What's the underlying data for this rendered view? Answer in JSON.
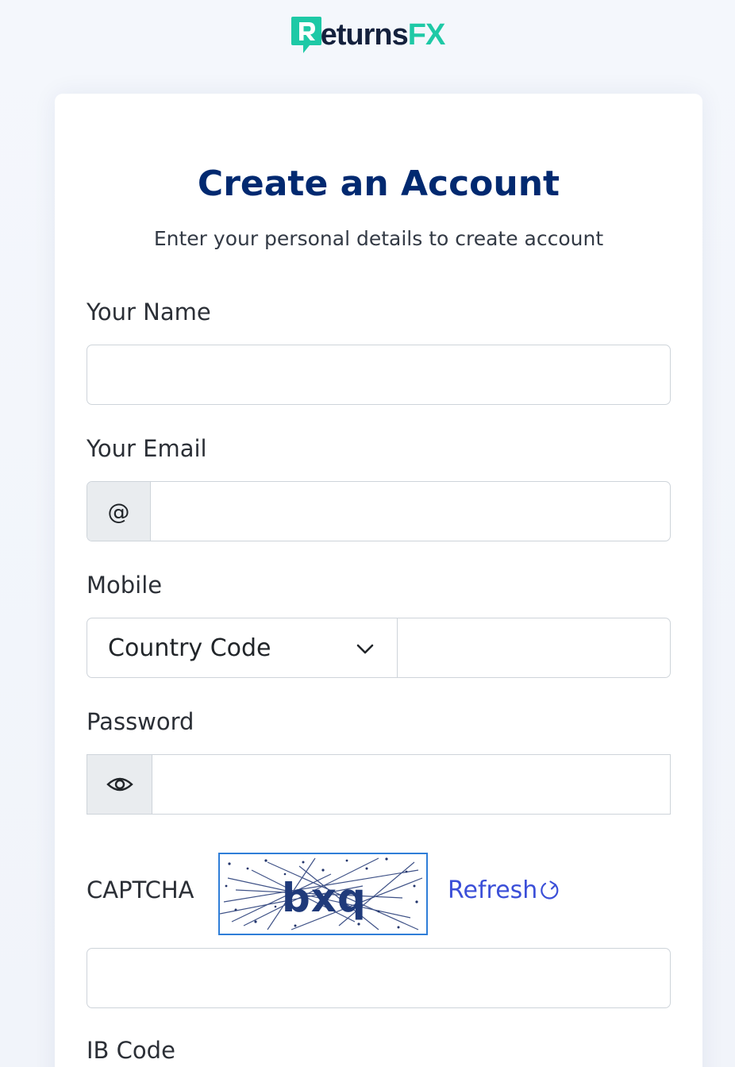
{
  "brand": {
    "name_main": "eturns",
    "name_accent": "FX",
    "logo_letter": "R",
    "accent_color": "#1ec9a6"
  },
  "form": {
    "title": "Create an Account",
    "subtitle": "Enter your personal details to create account",
    "name_label": "Your Name",
    "name_value": "",
    "email_label": "Your Email",
    "email_prefix": "@",
    "email_value": "",
    "mobile_label": "Mobile",
    "country_code_selected": "Country Code",
    "phone_value": "",
    "password_label": "Password",
    "password_value": "",
    "captcha_label": "CAPTCHA",
    "captcha_text": "bxq",
    "refresh_label": "Refresh",
    "captcha_value": "",
    "ib_code_label": "IB Code"
  },
  "colors": {
    "title": "#012970",
    "link": "#3b4fd8",
    "border": "#ced4da",
    "addon_bg": "#e9ecef"
  }
}
